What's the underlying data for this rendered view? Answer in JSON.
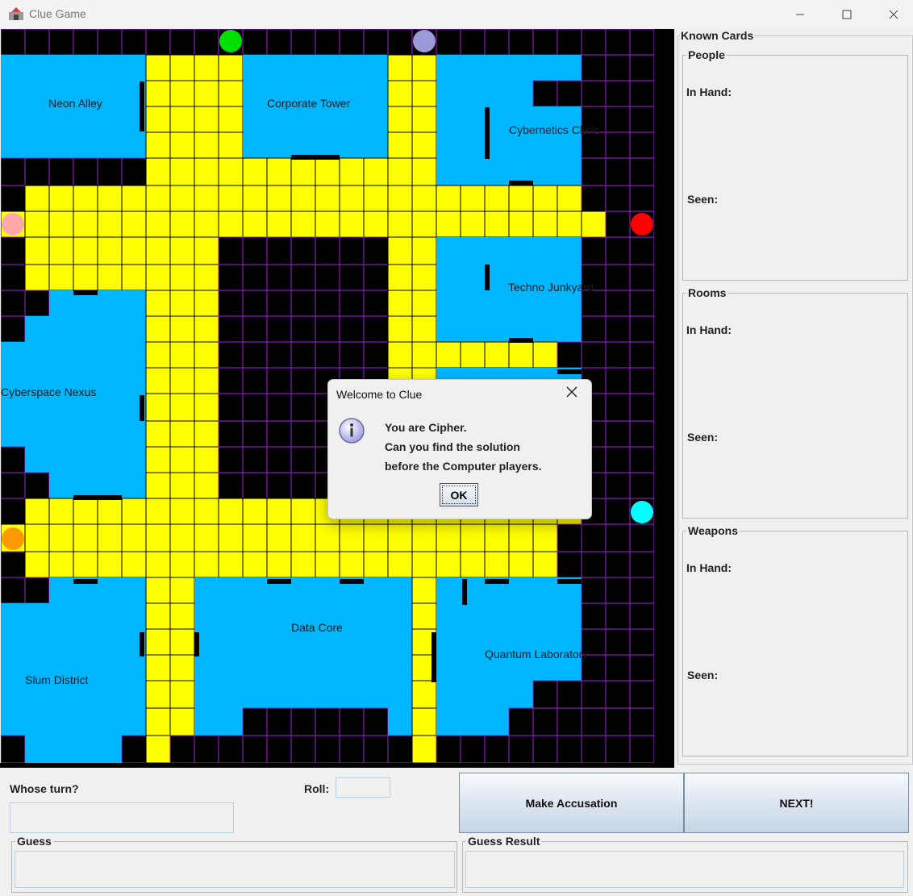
{
  "window": {
    "title": "Clue Game",
    "minimize_icon": "minimize-icon",
    "maximize_icon": "maximize-icon",
    "close_icon": "close-icon"
  },
  "colors": {
    "room": "#00b7ff",
    "walkway": "#ffff00",
    "unused": "#000000",
    "grid": "#9f24d9",
    "door": "#000000"
  },
  "rooms": [
    {
      "name": "Neon Alley"
    },
    {
      "name": "Corporate Tower"
    },
    {
      "name": "Cybernetics Clinic"
    },
    {
      "name": "Techno Junkyard"
    },
    {
      "name": "Cyberspace Nexus"
    },
    {
      "name": "Data Core"
    },
    {
      "name": "Quantum Laboratory"
    },
    {
      "name": "Slum District"
    }
  ],
  "players": [
    {
      "color": "#00e000"
    },
    {
      "color": "#9a9ad8"
    },
    {
      "color": "#ffa8a8"
    },
    {
      "color": "#ff0000"
    },
    {
      "color": "#00ffff"
    },
    {
      "color": "#ff9900"
    }
  ],
  "known_cards": {
    "title": "Known Cards",
    "sections": [
      {
        "title": "People",
        "in_hand": "In Hand:",
        "seen": "Seen:"
      },
      {
        "title": "Rooms",
        "in_hand": "In Hand:",
        "seen": "Seen:"
      },
      {
        "title": "Weapons",
        "in_hand": "In Hand:",
        "seen": "Seen:"
      }
    ]
  },
  "control": {
    "whose_turn_label": "Whose turn?",
    "whose_turn_value": "",
    "roll_label": "Roll:",
    "roll_value": "",
    "accuse_button": "Make Accusation",
    "next_button": "NEXT!",
    "guess_label": "Guess",
    "guess_value": "",
    "guess_result_label": "Guess Result",
    "guess_result_value": ""
  },
  "dialog": {
    "title": "Welcome to Clue",
    "icon": "info-icon",
    "lines": [
      "You are Cipher.",
      "Can you find the solution",
      "before the Computer players."
    ],
    "ok": "OK"
  }
}
